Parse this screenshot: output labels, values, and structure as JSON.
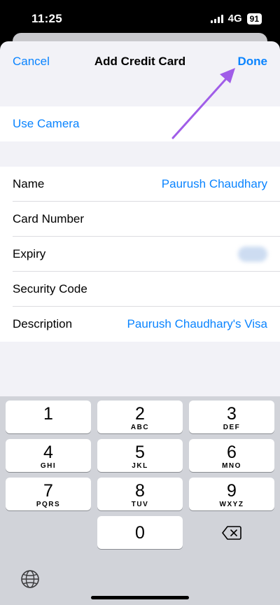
{
  "status_bar": {
    "time": "11:25",
    "network": "4G",
    "battery": "91"
  },
  "nav": {
    "cancel": "Cancel",
    "title": "Add Credit Card",
    "done": "Done"
  },
  "camera": {
    "label": "Use Camera"
  },
  "form": {
    "rows": [
      {
        "label": "Name",
        "value": "Paurush Chaudhary"
      },
      {
        "label": "Card Number",
        "value": ""
      },
      {
        "label": "Expiry",
        "value": ""
      },
      {
        "label": "Security Code",
        "value": ""
      },
      {
        "label": "Description",
        "value": "Paurush Chaudhary's Visa"
      }
    ]
  },
  "keyboard": {
    "keys": [
      {
        "num": "1",
        "letters": ""
      },
      {
        "num": "2",
        "letters": "ABC"
      },
      {
        "num": "3",
        "letters": "DEF"
      },
      {
        "num": "4",
        "letters": "GHI"
      },
      {
        "num": "5",
        "letters": "JKL"
      },
      {
        "num": "6",
        "letters": "MNO"
      },
      {
        "num": "7",
        "letters": "PQRS"
      },
      {
        "num": "8",
        "letters": "TUV"
      },
      {
        "num": "9",
        "letters": "WXYZ"
      },
      {
        "num": "0",
        "letters": ""
      }
    ]
  },
  "colors": {
    "accent": "#0a84ff",
    "annotation_arrow": "#a05de8"
  },
  "icons": [
    "signal-icon",
    "battery-icon",
    "delete-icon",
    "globe-icon",
    "annotation-arrow-icon"
  ]
}
